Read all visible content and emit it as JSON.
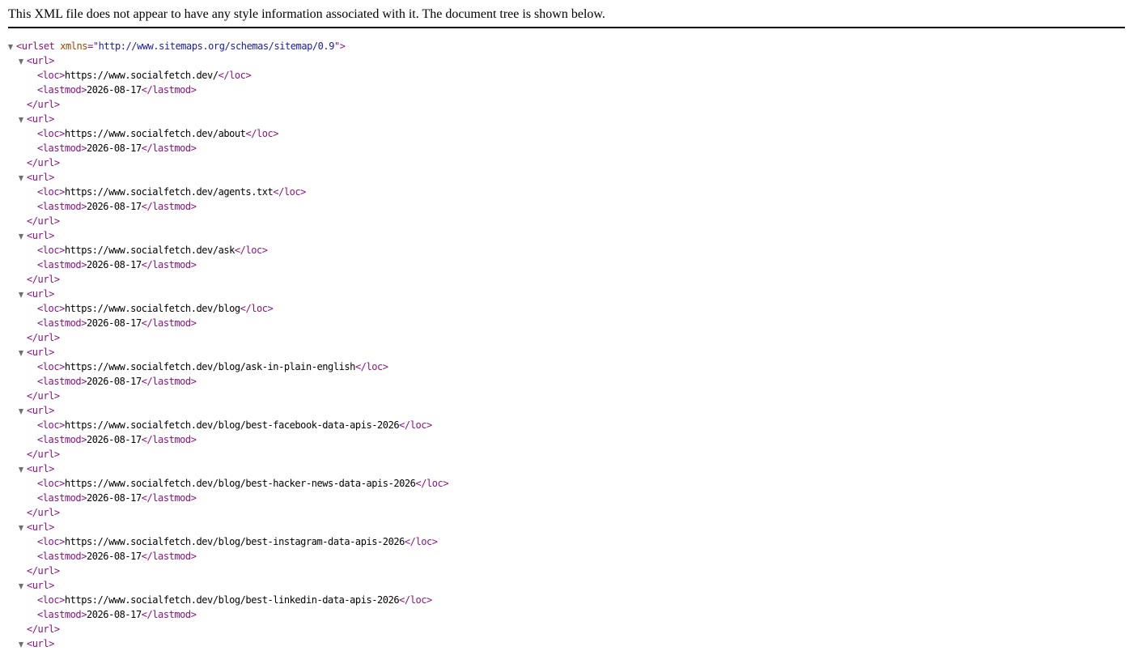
{
  "header": {
    "message": "This XML file does not appear to have any style information associated with it. The document tree is shown below."
  },
  "icons": {
    "toggle": "triangle-down-icon"
  },
  "colors": {
    "tag": "#881280",
    "attribute_name": "#994500",
    "attribute_value": "#1a1aa6",
    "toggle": "#6e6e6e"
  },
  "root": {
    "open": "<urlset",
    "attr_name": " xmlns",
    "attr_eq": "=\"",
    "attr_value": "http://www.sitemaps.org/schemas/sitemap/0.9",
    "attr_close": "\">"
  },
  "tags": {
    "url_open": "<url>",
    "url_close": "</url>",
    "loc_open": "<loc>",
    "loc_close": "</loc>",
    "lastmod_open": "<lastmod>",
    "lastmod_close": "</lastmod>"
  },
  "urls": [
    {
      "loc": "https://www.socialfetch.dev/",
      "lastmod": "2026-08-17"
    },
    {
      "loc": "https://www.socialfetch.dev/about",
      "lastmod": "2026-08-17"
    },
    {
      "loc": "https://www.socialfetch.dev/agents.txt",
      "lastmod": "2026-08-17"
    },
    {
      "loc": "https://www.socialfetch.dev/ask",
      "lastmod": "2026-08-17"
    },
    {
      "loc": "https://www.socialfetch.dev/blog",
      "lastmod": "2026-08-17"
    },
    {
      "loc": "https://www.socialfetch.dev/blog/ask-in-plain-english",
      "lastmod": "2026-08-17"
    },
    {
      "loc": "https://www.socialfetch.dev/blog/best-facebook-data-apis-2026",
      "lastmod": "2026-08-17"
    },
    {
      "loc": "https://www.socialfetch.dev/blog/best-hacker-news-data-apis-2026",
      "lastmod": "2026-08-17"
    },
    {
      "loc": "https://www.socialfetch.dev/blog/best-instagram-data-apis-2026",
      "lastmod": "2026-08-17"
    },
    {
      "loc": "https://www.socialfetch.dev/blog/best-linkedin-data-apis-2026",
      "lastmod": "2026-08-17"
    }
  ]
}
